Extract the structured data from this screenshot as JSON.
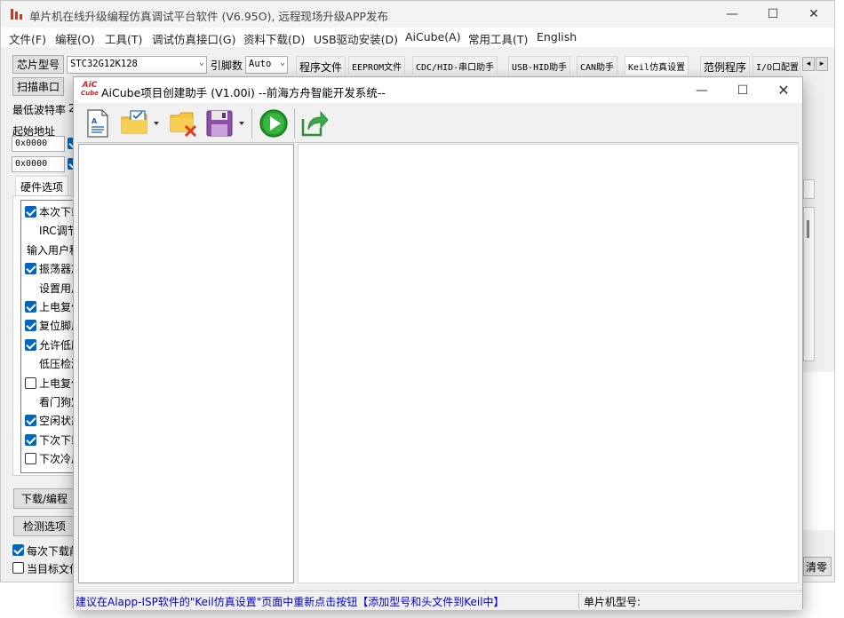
{
  "main_window": {
    "title": "单片机在线升级编程仿真调试平台软件 (V6.95O), 远程现场升级APP发布",
    "controls": {
      "minimize": "—",
      "maximize": "☐",
      "close": "✕"
    }
  },
  "menu": [
    "文件(F)",
    "编程(O)",
    "工具(T)",
    "调试仿真接口(G)",
    "资料下载(D)",
    "USB驱动安装(D)",
    "AiCube(A)",
    "常用工具(T)",
    "English"
  ],
  "chip": {
    "label": "芯片型号",
    "value": "STC32G12K128",
    "pin_label": "引脚数",
    "pin_value": "Auto"
  },
  "tabs": [
    "程序文件",
    "EEPROM文件",
    "CDC/HID-串口助手",
    "USB-HID助手",
    "CAN助手",
    "Keil仿真设置",
    "范例程序",
    "I/O口配置"
  ],
  "tab_scroll": {
    "left": "◂",
    "right": "▸"
  },
  "left_panel": {
    "scan_port": "扫描串口",
    "min_baud_label": "最低波特率",
    "min_baud_value": "2",
    "start_addr_label": "起始地址",
    "addr1": "0x0000",
    "addr2": "0x0000",
    "hw_tab": "硬件选项",
    "options": [
      {
        "text": "本次下载",
        "checked": true,
        "indent": false
      },
      {
        "text": "IRC调节",
        "checked": null,
        "indent": true
      },
      {
        "text": "输入用户程",
        "checked": null,
        "indent": false
      },
      {
        "text": "振荡器放",
        "checked": true,
        "indent": false
      },
      {
        "text": "设置用户",
        "checked": null,
        "indent": true
      },
      {
        "text": "上电复位",
        "checked": true,
        "indent": false
      },
      {
        "text": "复位脚用",
        "checked": true,
        "indent": false
      },
      {
        "text": "允许低压",
        "checked": true,
        "indent": false
      },
      {
        "text": "低压检测",
        "checked": null,
        "indent": true
      },
      {
        "text": "上电复位",
        "checked": false,
        "indent": false
      },
      {
        "text": "看门狗定",
        "checked": null,
        "indent": true
      },
      {
        "text": "空闲状态",
        "checked": true,
        "indent": false
      },
      {
        "text": "下次下载",
        "checked": true,
        "indent": false
      },
      {
        "text": "下次冷启",
        "checked": false,
        "indent": false
      }
    ],
    "download_btn": "下载/编程",
    "check_btn": "检测选项",
    "bottom_cb1": "每次下载前",
    "bottom_cb2": "当目标文件"
  },
  "right_btn": "清零",
  "dialog": {
    "logo_top": "AiC",
    "logo_bottom": "Cube",
    "title": "AiCube项目创建助手 (V1.00i) --前海方舟智能开发系统--",
    "controls": {
      "minimize": "—",
      "maximize": "☐",
      "close": "✕"
    },
    "toolbar": [
      "new-file-icon",
      "open-project-icon",
      "delete-project-icon",
      "save-icon",
      "run-icon",
      "export-icon"
    ],
    "status_message": "建议在Alapp-ISP软件的\"Keil仿真设置\"页面中重新点击按钮【添加型号和头文件到Keil中】",
    "chip_model_label": "单片机型号:",
    "colors": {
      "status_text": "#0000cc",
      "run_green": "#1f9a2a"
    }
  }
}
